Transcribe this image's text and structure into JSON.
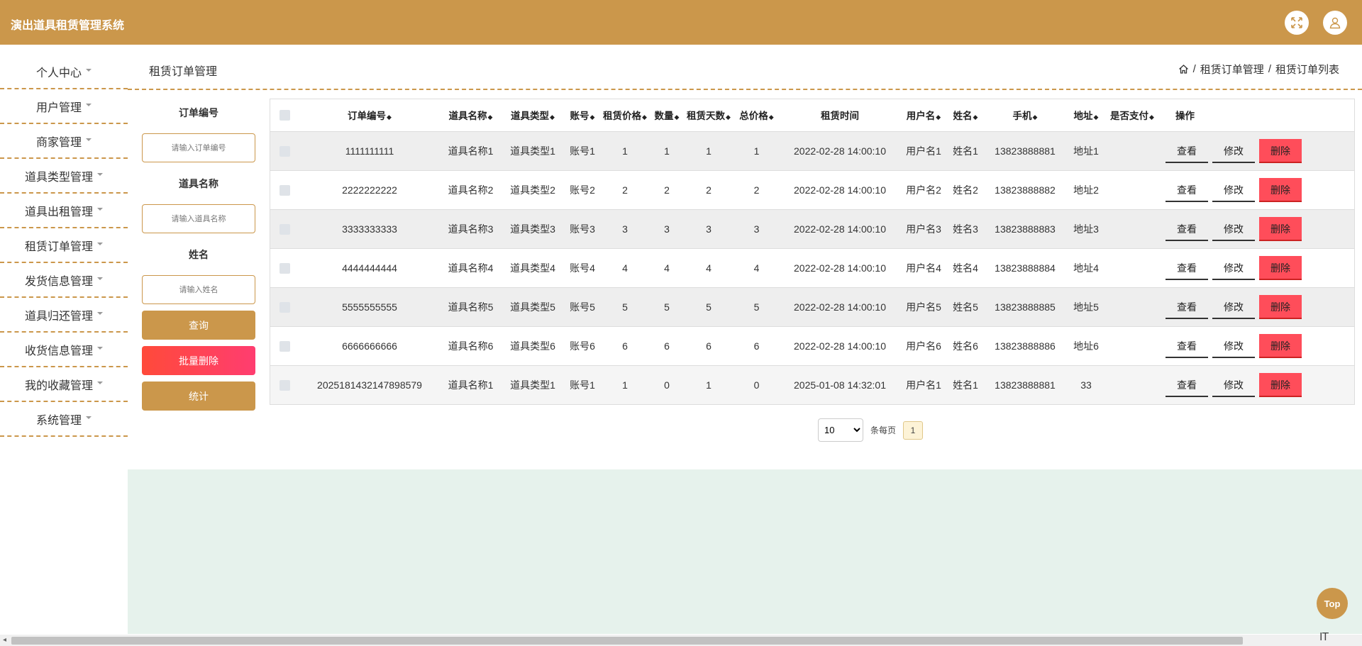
{
  "header": {
    "title": "演出道具租赁管理系统",
    "fullscreen_icon": "expand-icon",
    "user_icon": "user-icon",
    "accent": "#cb974b"
  },
  "sidebar": {
    "items": [
      {
        "label": "个人中心"
      },
      {
        "label": "用户管理"
      },
      {
        "label": "商家管理"
      },
      {
        "label": "道具类型管理"
      },
      {
        "label": "道具出租管理"
      },
      {
        "label": "租赁订单管理"
      },
      {
        "label": "发货信息管理"
      },
      {
        "label": "道具归还管理"
      },
      {
        "label": "收货信息管理"
      },
      {
        "label": "我的收藏管理"
      },
      {
        "label": "系统管理"
      }
    ]
  },
  "page": {
    "title": "租赁订单管理",
    "breadcrumb": [
      "租赁订单管理",
      "租赁订单列表"
    ],
    "breadcrumb_sep": "/"
  },
  "search": {
    "order_no_label": "订单编号",
    "order_no_placeholder": "请输入订单编号",
    "item_name_label": "道具名称",
    "item_name_placeholder": "请输入道具名称",
    "name_label": "姓名",
    "name_placeholder": "请输入姓名",
    "query_btn": "查询",
    "batch_delete_btn": "批量删除",
    "stats_btn": "统计"
  },
  "table": {
    "headers": [
      "订单编号",
      "道具名称",
      "道具类型",
      "账号",
      "租赁价格",
      "数量",
      "租赁天数",
      "总价格",
      "租赁时间",
      "用户名",
      "姓名",
      "手机",
      "地址",
      "是否支付",
      "操作"
    ],
    "sortable": [
      true,
      true,
      true,
      true,
      true,
      true,
      true,
      true,
      false,
      true,
      true,
      true,
      true,
      true,
      false
    ],
    "rows": [
      [
        "1111111111",
        "道具名称1",
        "道具类型1",
        "账号1",
        "1",
        "1",
        "1",
        "1",
        "2022-02-28 14:00:10",
        "用户名1",
        "姓名1",
        "13823888881",
        "地址1",
        ""
      ],
      [
        "2222222222",
        "道具名称2",
        "道具类型2",
        "账号2",
        "2",
        "2",
        "2",
        "2",
        "2022-02-28 14:00:10",
        "用户名2",
        "姓名2",
        "13823888882",
        "地址2",
        ""
      ],
      [
        "3333333333",
        "道具名称3",
        "道具类型3",
        "账号3",
        "3",
        "3",
        "3",
        "3",
        "2022-02-28 14:00:10",
        "用户名3",
        "姓名3",
        "13823888883",
        "地址3",
        ""
      ],
      [
        "4444444444",
        "道具名称4",
        "道具类型4",
        "账号4",
        "4",
        "4",
        "4",
        "4",
        "2022-02-28 14:00:10",
        "用户名4",
        "姓名4",
        "13823888884",
        "地址4",
        ""
      ],
      [
        "5555555555",
        "道具名称5",
        "道具类型5",
        "账号5",
        "5",
        "5",
        "5",
        "5",
        "2022-02-28 14:00:10",
        "用户名5",
        "姓名5",
        "13823888885",
        "地址5",
        ""
      ],
      [
        "6666666666",
        "道具名称6",
        "道具类型6",
        "账号6",
        "6",
        "6",
        "6",
        "6",
        "2022-02-28 14:00:10",
        "用户名6",
        "姓名6",
        "13823888886",
        "地址6",
        ""
      ],
      [
        "2025181432147898579",
        "道具名称1",
        "道具类型1",
        "账号1",
        "1",
        "0",
        "1",
        "0",
        "2025-01-08 14:32:01",
        "用户名1",
        "姓名1",
        "13823888881",
        "33",
        ""
      ]
    ],
    "actions": {
      "view": "查看",
      "edit": "修改",
      "delete": "删除"
    }
  },
  "pagination": {
    "page_size": "10",
    "page_size_options": [
      "10"
    ],
    "per_page_label": "条每页",
    "current_page": "1"
  },
  "top_button": "Top",
  "corner_text": "IT"
}
